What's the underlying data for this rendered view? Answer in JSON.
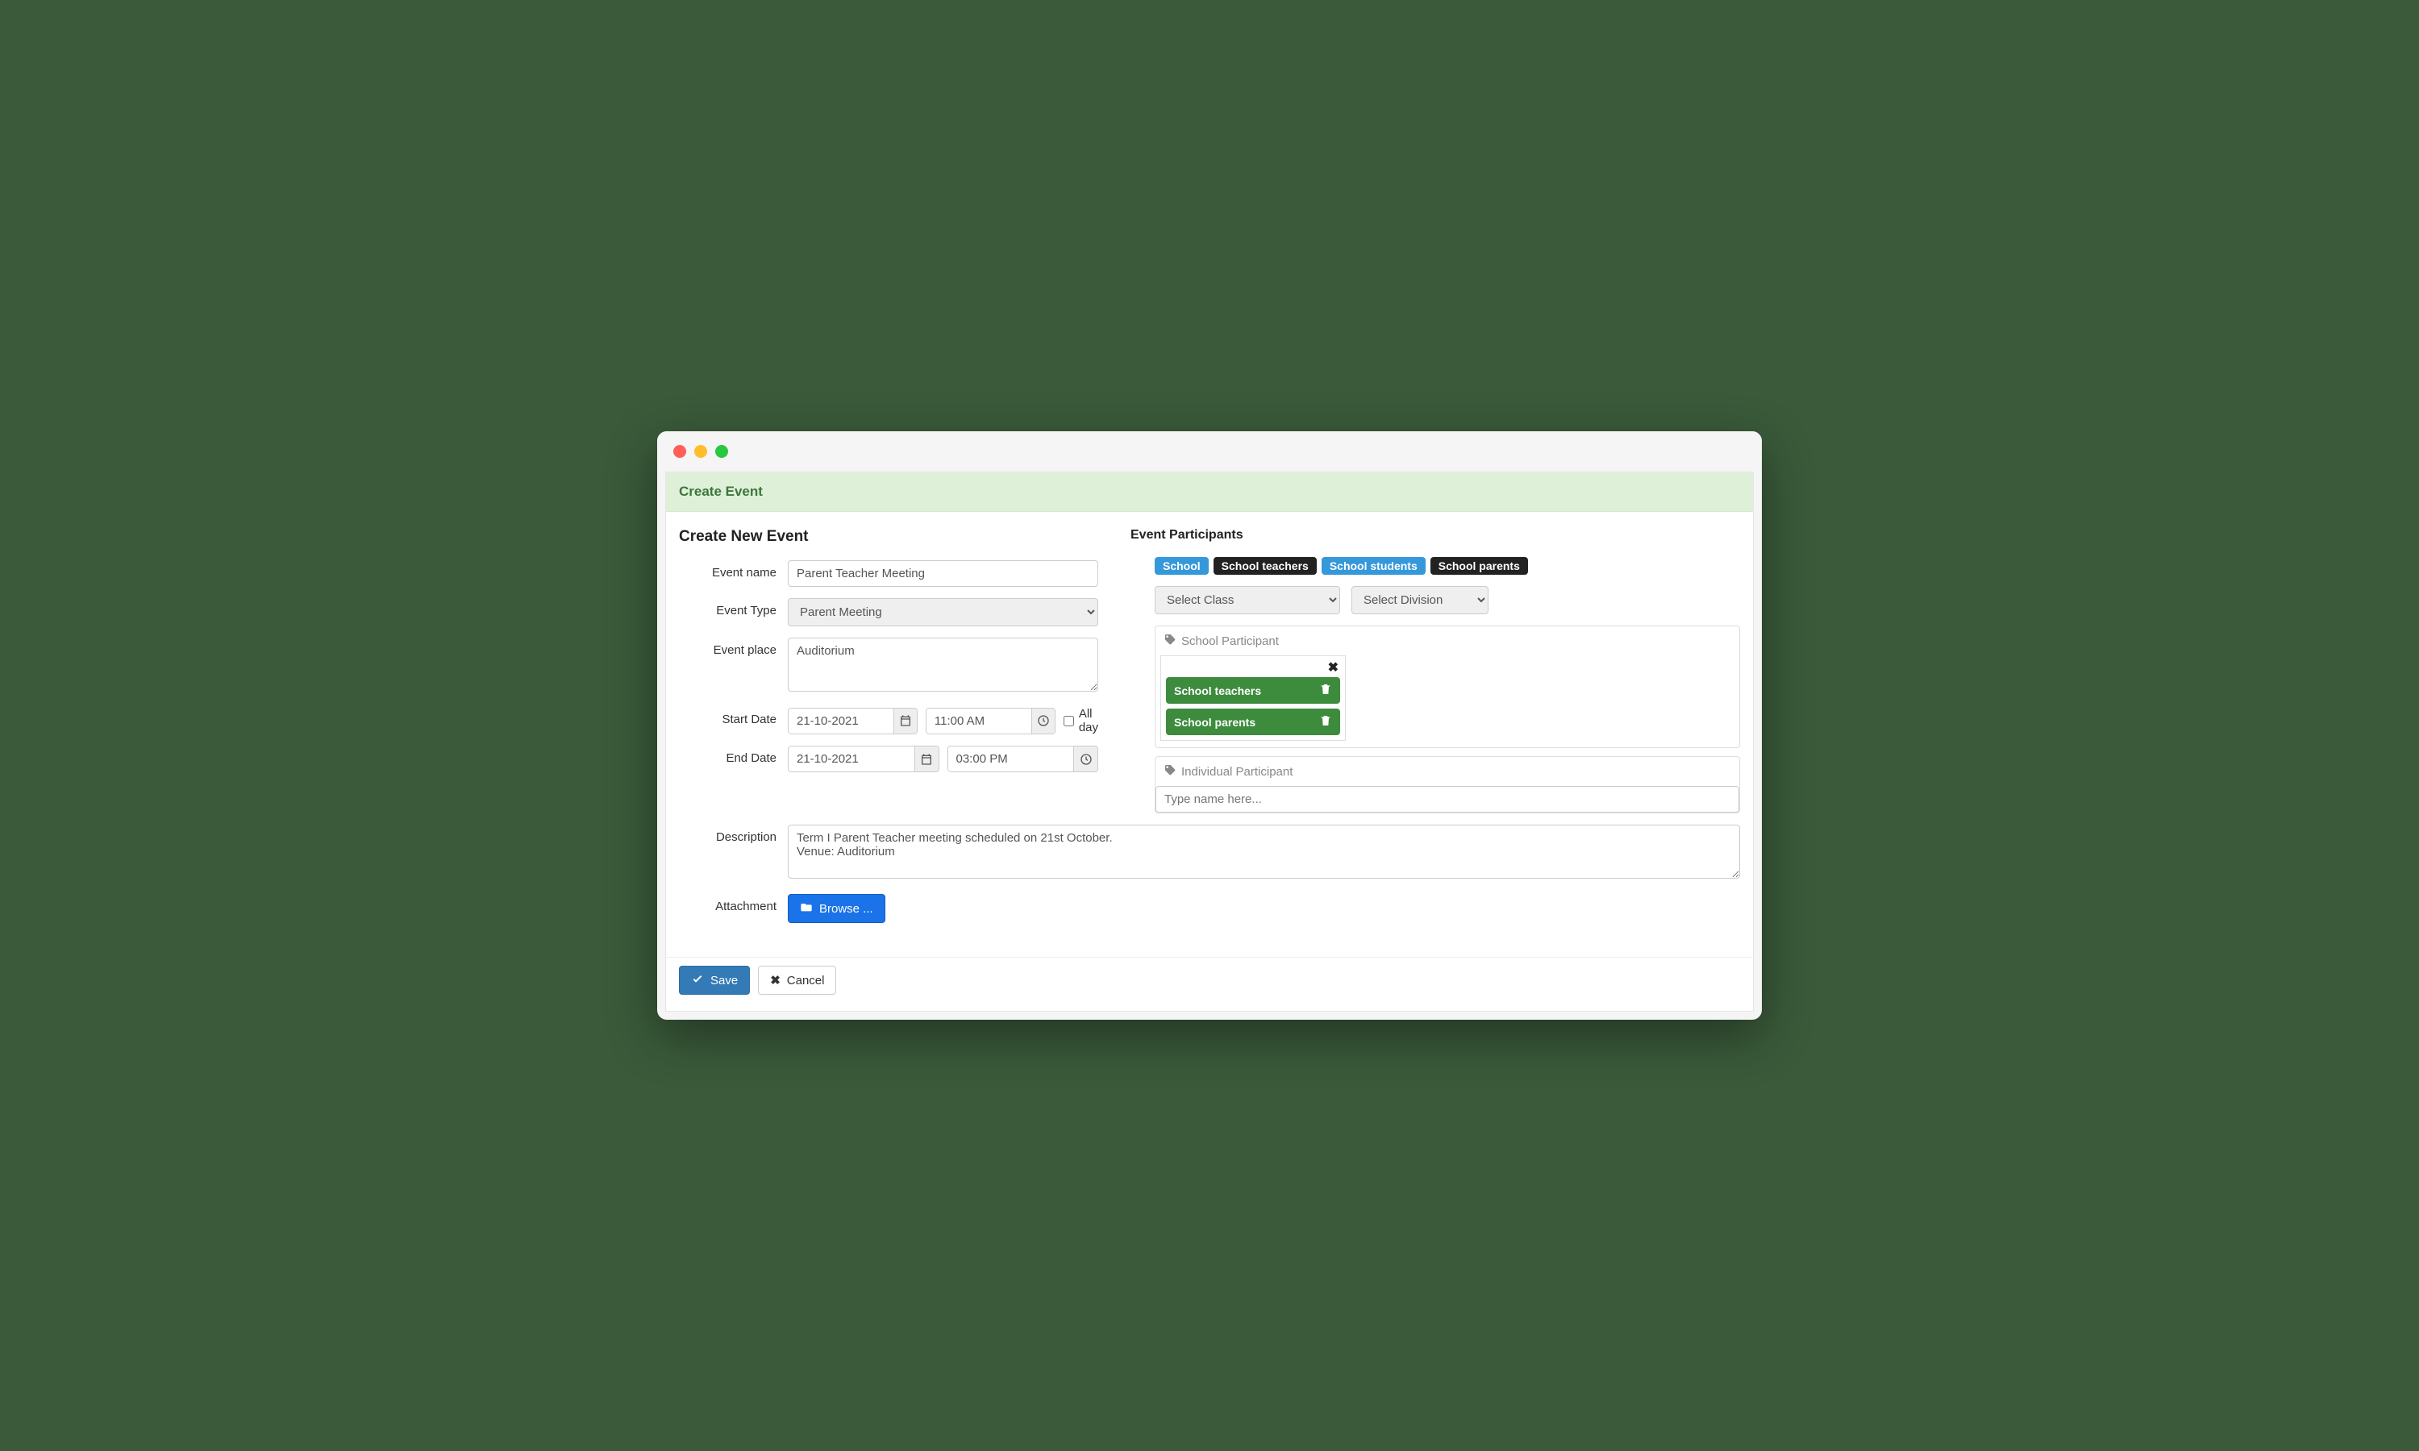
{
  "panel_title": "Create Event",
  "left": {
    "heading": "Create New Event",
    "labels": {
      "event_name": "Event name",
      "event_type": "Event Type",
      "event_place": "Event place",
      "start_date": "Start Date",
      "end_date": "End Date",
      "description": "Description",
      "attachment": "Attachment"
    },
    "values": {
      "event_name": "Parent Teacher Meeting",
      "event_type": "Parent Meeting",
      "event_place": "Auditorium",
      "start_date": "21-10-2021",
      "start_time": "11:00 AM",
      "end_date": "21-10-2021",
      "end_time": "03:00 PM",
      "description": "Term I Parent Teacher meeting scheduled on 21st October.\nVenue: Auditorium"
    },
    "all_day_label": "All day",
    "browse_label": "Browse ..."
  },
  "right": {
    "heading": "Event Participants",
    "tags": {
      "school": "School",
      "teachers": "School teachers",
      "students": "School students",
      "parents": "School parents"
    },
    "select_class": "Select Class",
    "select_division": "Select Division",
    "school_participant_label": "School Participant",
    "individual_participant_label": "Individual Participant",
    "chips": {
      "teachers": "School teachers",
      "parents": "School parents"
    },
    "type_name_placeholder": "Type name here..."
  },
  "footer": {
    "save": "Save",
    "cancel": "Cancel"
  }
}
